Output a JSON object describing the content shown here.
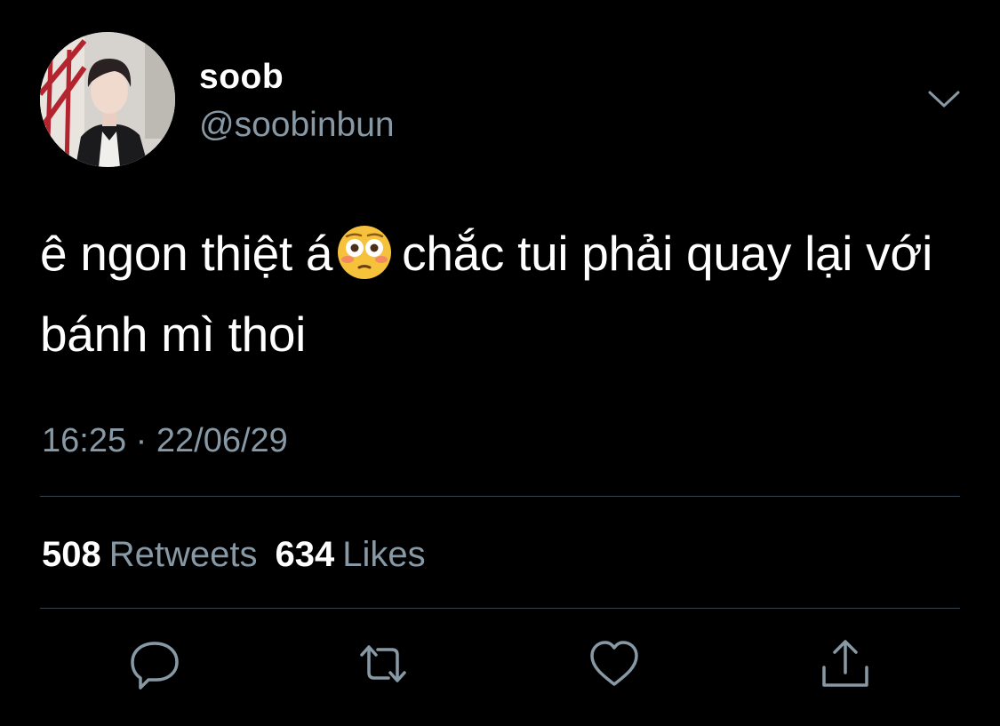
{
  "user": {
    "display_name": "soob",
    "handle": "@soobinbun"
  },
  "tweet": {
    "text_before_emoji": "ê ngon thiệt á",
    "emoji": "flushed-face",
    "text_after_emoji": "chắc tui phải quay lại với bánh mì thoi",
    "timestamp": "16:25 · 22/06/29"
  },
  "stats": {
    "retweets_count": "508",
    "retweets_label": "Retweets",
    "likes_count": "634",
    "likes_label": "Likes"
  },
  "actions": [
    "reply-icon",
    "retweet-icon",
    "like-icon",
    "share-icon"
  ],
  "colors": {
    "background": "#000000",
    "primary_text": "#ffffff",
    "secondary_text": "#8899a6",
    "divider": "#38444d"
  }
}
